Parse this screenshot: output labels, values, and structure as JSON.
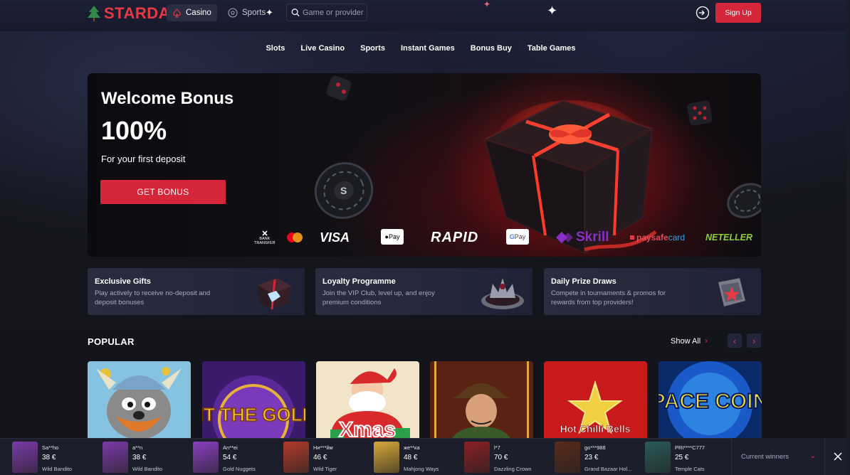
{
  "header": {
    "logo_text": "STARDA",
    "casino_label": "Casino",
    "sports_label": "Sports",
    "search_placeholder": "Game or provider",
    "signup_label": "Sign Up"
  },
  "category_nav": [
    "Slots",
    "Live Casino",
    "Sports",
    "Instant Games",
    "Bonus Buy",
    "Table Games"
  ],
  "hero": {
    "title": "Welcome Bonus",
    "percent": "100%",
    "subtitle": "For your first deposit",
    "button_label": "GET BONUS",
    "payments": {
      "bank": [
        "BANK",
        "TRANSFER"
      ],
      "visa": "VISA",
      "applepay": "Pay",
      "rapid": "RAPID",
      "gpay": "Pay",
      "skrill": "Skrill",
      "paysafe_a": "paysafe",
      "paysafe_b": "card",
      "neteller": "NETELLER"
    }
  },
  "promos": [
    {
      "title": "Exclusive Gifts",
      "desc": "Play actively to receive no-deposit and deposit bonuses"
    },
    {
      "title": "Loyalty Programme",
      "desc": "Join the VIP Club, level up, and enjoy premium conditions"
    },
    {
      "title": "Daily Prize Draws",
      "desc": "Compete in tournaments & promos for rewards from top providers!"
    }
  ],
  "popular": {
    "title": "POPULAR",
    "show_all": "Show All",
    "tiles": [
      {
        "title": ""
      },
      {
        "title": "HIT THE GOLD!"
      },
      {
        "title": "Xmas"
      },
      {
        "title": ""
      },
      {
        "title": "Hot Chilli Bells"
      },
      {
        "title": "SPACE COINS"
      }
    ]
  },
  "winners": [
    {
      "name": "Sa**ho",
      "amount": "38 €",
      "game": "Wild Bandito",
      "thumb_color": "#7b3aa8"
    },
    {
      "name": "a**n",
      "amount": "38 €",
      "game": "Wild Bandito",
      "thumb_color": "#7b3aa8"
    },
    {
      "name": "An**ei",
      "amount": "54 €",
      "game": "Gold Nuggets",
      "thumb_color": "#8a3fc0"
    },
    {
      "name": "Ни***йм",
      "amount": "46 €",
      "game": "Wild Tiger",
      "thumb_color": "#b23a2a"
    },
    {
      "name": "же**ка",
      "amount": "48 €",
      "game": "Mahjong Ways",
      "thumb_color": "#d9a83a"
    },
    {
      "name": "l*7",
      "amount": "70 €",
      "game": "Dazzling Crown",
      "thumb_color": "#8a1f24"
    },
    {
      "name": "go***988",
      "amount": "23 €",
      "game": "Grand Bazaar Hol...",
      "thumb_color": "#5a2a1a"
    },
    {
      "name": "PRI****C777",
      "amount": "25 €",
      "game": "Temple Cats",
      "thumb_color": "#2a5a5a"
    }
  ],
  "current_winners_label": "Current winners",
  "colors": {
    "accent": "#d5263a",
    "bg": "#15161f",
    "card": "#262939"
  }
}
